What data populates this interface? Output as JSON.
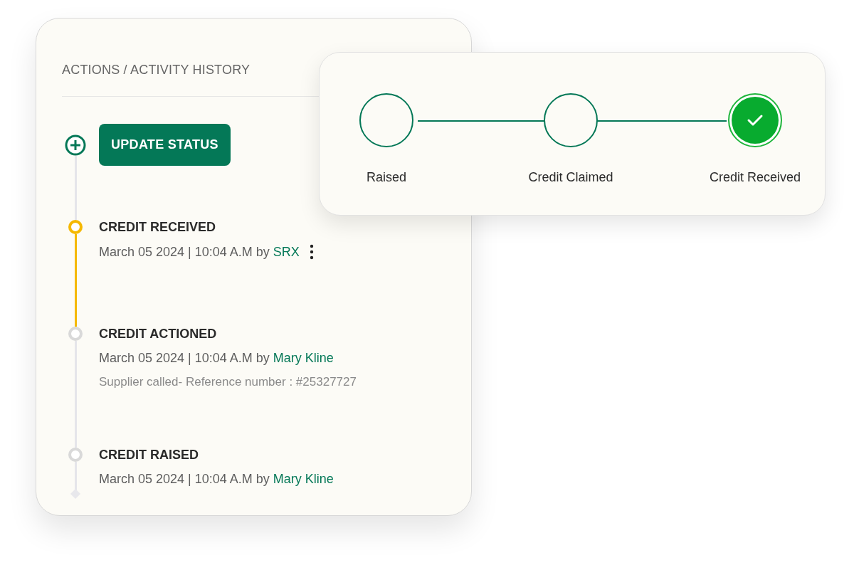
{
  "activity_card": {
    "title": "ACTIONS / ACTIVITY HISTORY",
    "action_button": "UPDATE STATUS",
    "events": [
      {
        "title": "CREDIT RECEIVED",
        "meta": "March 05 2024 | 10:04 A.M by",
        "user": "SRX",
        "current": true,
        "has_menu": true
      },
      {
        "title": "CREDIT ACTIONED",
        "meta": "March 05 2024 | 10:04 A.M by",
        "user": "Mary Kline",
        "note": "Supplier called- Reference number : #25327727",
        "current": false,
        "has_menu": false
      },
      {
        "title": "CREDIT RAISED",
        "meta": "March 05 2024 | 10:04 A.M by",
        "user": "Mary Kline",
        "current": false,
        "has_menu": false
      }
    ]
  },
  "progress_card": {
    "steps": [
      {
        "label": "Raised",
        "completed": false
      },
      {
        "label": "Credit Claimed",
        "completed": false
      },
      {
        "label": "Credit Received",
        "completed": true
      }
    ]
  }
}
